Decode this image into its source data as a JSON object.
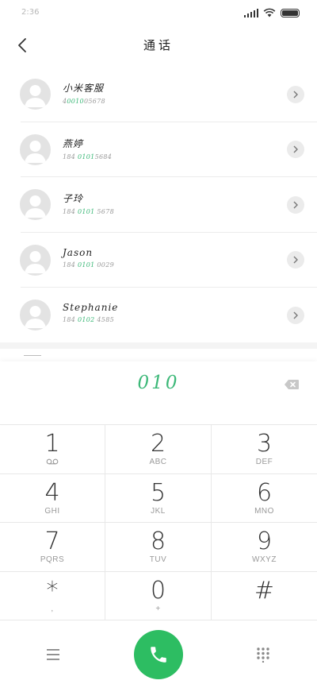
{
  "status_bar": {
    "time": "2:36"
  },
  "header": {
    "title": "通话"
  },
  "contacts": [
    {
      "name": "小米客服",
      "number_pre": "4",
      "number_hl": "0010",
      "number_post": "05678"
    },
    {
      "name": "燕婷",
      "number_pre": "184 ",
      "number_hl": "0101",
      "number_post": "5684"
    },
    {
      "name": "子玲",
      "number_pre": "184 ",
      "number_hl": "0101",
      "number_post": " 5678"
    },
    {
      "name": "Jason",
      "number_pre": "184 ",
      "number_hl": "0101",
      "number_post": " 0029"
    },
    {
      "name": "Stephanie",
      "number_pre": "184 ",
      "number_hl": "0102",
      "number_post": " 4585"
    }
  ],
  "dialer": {
    "input_value": "010"
  },
  "keypad": {
    "keys": [
      {
        "digit": "1",
        "letters": ""
      },
      {
        "digit": "2",
        "letters": "ABC"
      },
      {
        "digit": "3",
        "letters": "DEF"
      },
      {
        "digit": "4",
        "letters": "GHI"
      },
      {
        "digit": "5",
        "letters": "JKL"
      },
      {
        "digit": "6",
        "letters": "MNO"
      },
      {
        "digit": "7",
        "letters": "PQRS"
      },
      {
        "digit": "8",
        "letters": "TUV"
      },
      {
        "digit": "9",
        "letters": "WXYZ"
      },
      {
        "digit": "*",
        "letters": ","
      },
      {
        "digit": "0",
        "letters": "+"
      },
      {
        "digit": "#",
        "letters": ""
      }
    ],
    "voicemail_icon": "voicemail-icon"
  },
  "bottom_bar": {
    "menu_icon": "menu-icon",
    "call_icon": "phone-icon",
    "keypad_icon": "dialpad-icon"
  },
  "colors": {
    "accent": "#3cb878",
    "call_button": "#2dbd62"
  }
}
